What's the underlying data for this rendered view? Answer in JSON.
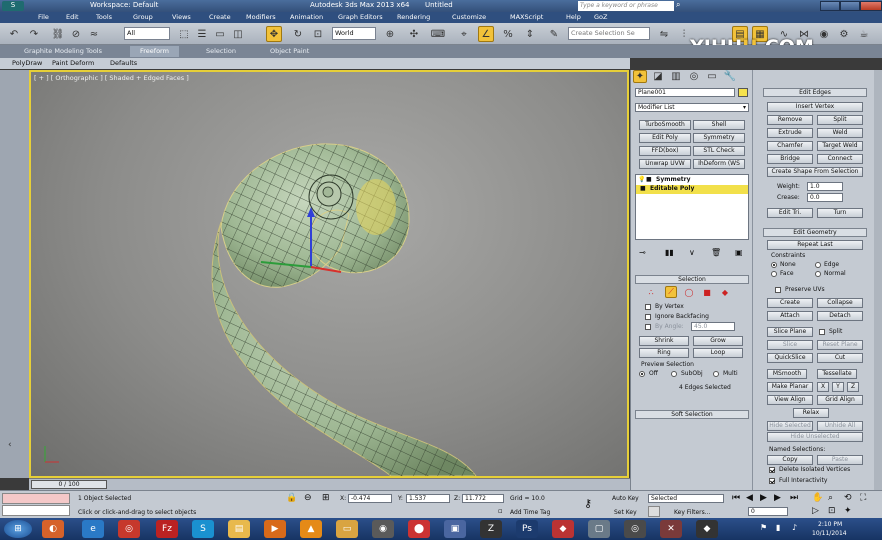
{
  "window": {
    "workspace": "Workspace: Default",
    "title": "Autodesk 3ds Max  2013 x64",
    "doc": "Untitled",
    "search_placeholder": "Type a keyword or phrase"
  },
  "menu": [
    "File",
    "Edit",
    "Tools",
    "Group",
    "Views",
    "Create",
    "Modifiers",
    "Animation",
    "Graph Editors",
    "Rendering",
    "Customize",
    "MAXScript",
    "Help",
    "GoZ"
  ],
  "toolbar": {
    "filter": "All",
    "coord": "World",
    "selection_set": "Create Selection Se"
  },
  "ribbon": {
    "tabs": [
      "Graphite Modeling Tools",
      "Freeform",
      "Selection",
      "Object Paint"
    ],
    "active": "Freeform",
    "sub": [
      "PolyDraw",
      "Paint Deform",
      "Defaults"
    ]
  },
  "viewport": {
    "label": "[ + ] [ Orthographic ] [ Shaded + Edged Faces ]"
  },
  "command_panel": {
    "object_name": "Plane001",
    "modifier_list": "Modifier List",
    "mod_buttons": [
      [
        "TurboSmooth",
        "Shell"
      ],
      [
        "Edit Poly",
        "Symmetry"
      ],
      [
        "FFD(box)",
        "STL Check"
      ],
      [
        "Unwrap UVW",
        "IhDeform (WS"
      ]
    ],
    "stack": [
      "Symmetry",
      "Editable Poly"
    ],
    "selection": {
      "header": "Selection",
      "by_vertex": "By Vertex",
      "ignore_backfacing": "Ignore Backfacing",
      "by_angle": "By Angle:",
      "by_angle_val": "45.0",
      "shrink": "Shrink",
      "grow": "Grow",
      "ring": "Ring",
      "loop": "Loop",
      "preview": "Preview Selection",
      "off": "Off",
      "subobj": "SubObj",
      "multi": "Multi",
      "status": "4 Edges Selected",
      "soft": "Soft Selection"
    }
  },
  "edit_edges": {
    "header": "Edit Edges",
    "insert_vertex": "Insert Vertex",
    "rows": [
      [
        "Remove",
        "Split"
      ],
      [
        "Extrude",
        "Weld"
      ],
      [
        "Chamfer",
        "Target Weld"
      ],
      [
        "Bridge",
        "Connect"
      ]
    ],
    "create_shape": "Create Shape From Selection",
    "weight_label": "Weight:",
    "weight": "1.0",
    "crease_label": "Crease:",
    "crease": "0.0",
    "edit_tri": "Edit Tri.",
    "turn": "Turn"
  },
  "edit_geometry": {
    "header": "Edit Geometry",
    "repeat_last": "Repeat Last",
    "constraints": "Constraints",
    "none": "None",
    "edge": "Edge",
    "face": "Face",
    "normal": "Normal",
    "preserve_uvs": "Preserve UVs",
    "create": "Create",
    "collapse": "Collapse",
    "attach": "Attach",
    "detach": "Detach",
    "slice_plane": "Slice Plane",
    "split": "Split",
    "slice": "Slice",
    "reset_plane": "Reset Plane",
    "quickslice": "QuickSlice",
    "cut": "Cut",
    "msmooth": "MSmooth",
    "tessellate": "Tessellate",
    "make_planar": "Make Planar",
    "x": "X",
    "y": "Y",
    "z": "Z",
    "view_align": "View Align",
    "grid_align": "Grid Align",
    "relax": "Relax",
    "hide_sel": "Hide Selected",
    "unhide_all": "Unhide All",
    "hide_unsel": "Hide Unselected",
    "named_sel": "Named Selections:",
    "copy": "Copy",
    "paste": "Paste",
    "delete_iso": "Delete Isolated Vertices",
    "full_inter": "Full Interactivity"
  },
  "timeline": {
    "frame": "0 / 100"
  },
  "status": {
    "selected": "1 Object Selected",
    "prompt": "Click or click-and-drag to select objects",
    "x_label": "X:",
    "x": "-0.474",
    "y_label": "Y:",
    "y": "1.537",
    "z_label": "Z:",
    "z": "11.772",
    "grid": "Grid = 10.0",
    "add_time_tag": "Add Time Tag",
    "auto_key": "Auto Key",
    "set_key": "Set Key",
    "key_mode": "Selected",
    "key_filters": "Key Filters...",
    "frame_field": "0"
  },
  "taskbar": {
    "time": "2:10 PM",
    "date": "10/11/2014"
  },
  "watermark": {
    "a": "YIHU",
    "b": "U",
    "c": ".COM"
  },
  "colors": {
    "viewport_border": "#e6cf38",
    "highlight": "#f2c23a",
    "mesh": "#a9c4a2"
  }
}
